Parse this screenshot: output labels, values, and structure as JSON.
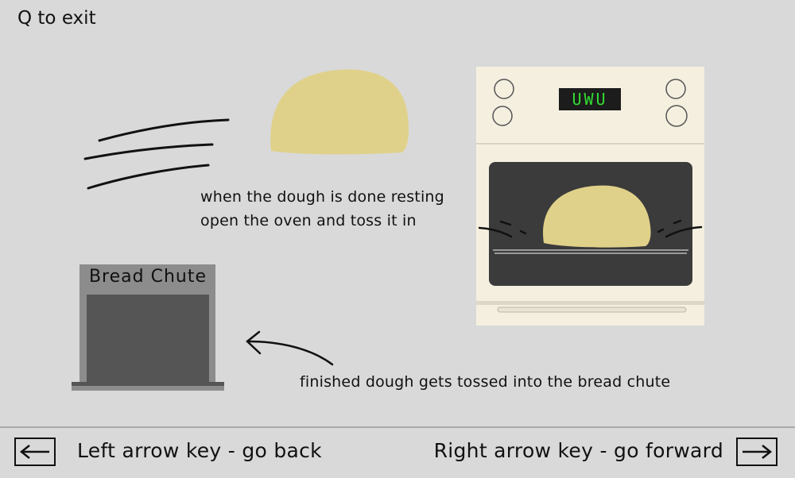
{
  "header": {
    "exit_hint": "Q to exit"
  },
  "scene": {
    "resting_caption_line1": "when the dough is done resting",
    "resting_caption_line2": "open the oven and toss it in",
    "chute_caption": "finished dough gets tossed into the bread chute",
    "chute_sign": "Bread Chute",
    "oven_display": "UWU"
  },
  "navigation": {
    "back_label": "Left arrow key - go back",
    "forward_label": "Right arrow key - go forward",
    "left_icon": "left-arrow-icon",
    "right_icon": "right-arrow-icon"
  },
  "colors": {
    "background": "#d9d9d9",
    "dough": "#e0d18a",
    "oven_body": "#f4efdf",
    "oven_window": "#3b3b3b",
    "chute_frame": "#8c8c8c",
    "chute_opening": "#555555",
    "display_text": "#33dd33"
  }
}
